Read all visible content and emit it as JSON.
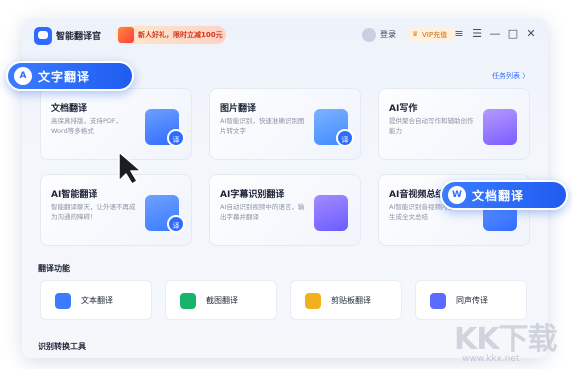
{
  "app": {
    "name": "智能翻译官",
    "promo_text": "新人好礼，限时立减100元",
    "login_label": "登录",
    "vip_icon": "crown-icon",
    "vip_label": "VIP充值"
  },
  "window_controls": {
    "settings": "≡",
    "menu": "☰",
    "minimize": "—",
    "maximize": "□",
    "close": "✕"
  },
  "task_list_label": "任务列表 〉",
  "cards": [
    {
      "title": "文档翻译",
      "desc": "高保真排版，支持PDF，Word等多格式",
      "art_color": "#3a7bff",
      "badge": "译"
    },
    {
      "title": "图片翻译",
      "desc": "AI智能识别，快速准确识别图片转文字",
      "art_color": "#3f8bff",
      "badge": "译"
    },
    {
      "title": "AI写作",
      "desc": "提供聚合自动写作和辅助创作能力",
      "art_color": "#7c5cff",
      "badge": ""
    },
    {
      "title": "AI智能翻译",
      "desc": "智能翻译聊天，让外语不再成为沟通的障碍！",
      "art_color": "#3a7bff",
      "badge": "译"
    },
    {
      "title": "AI字幕识别翻译",
      "desc": "AI自动识别视频中的语言，输出字幕并翻译",
      "art_color": "#6a5cff",
      "badge": ""
    },
    {
      "title": "AI音视频总结",
      "desc": "AI智能识别音视频内容，高效生成全文总结",
      "art_color": "#2f6bff",
      "badge": ""
    }
  ],
  "section_translate": "翻译功能",
  "tools": [
    {
      "label": "文本翻译",
      "icon": "text-translate-icon",
      "color": "#3a7bff"
    },
    {
      "label": "截图翻译",
      "icon": "screenshot-translate-icon",
      "color": "#19b46b"
    },
    {
      "label": "剪贴板翻译",
      "icon": "clipboard-translate-icon",
      "color": "#f2b01e"
    },
    {
      "label": "同声传译",
      "icon": "simultaneous-interpretation-icon",
      "color": "#5b6bff"
    }
  ],
  "section_recognize": "识别转换工具",
  "overlay_badges": [
    {
      "label": "文字翻译",
      "icon_glyph": "A"
    },
    {
      "label": "文档翻译",
      "icon_glyph": "W"
    }
  ],
  "watermark": {
    "text": "KK下载",
    "url": "www.kkx.net"
  }
}
